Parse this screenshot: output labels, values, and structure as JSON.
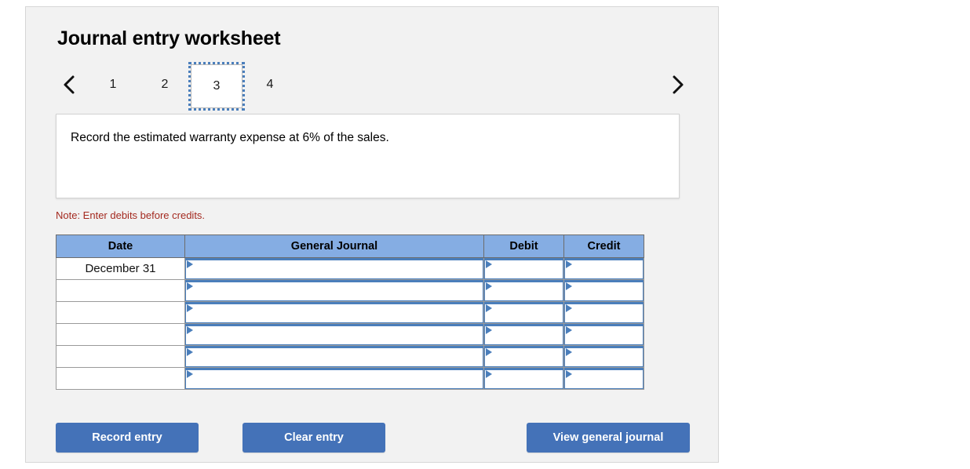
{
  "page": {
    "title": "Journal entry worksheet"
  },
  "pager": {
    "prev_icon": "chevron-left-icon",
    "next_icon": "chevron-right-icon",
    "tabs": [
      {
        "label": "1",
        "active": false
      },
      {
        "label": "2",
        "active": false
      },
      {
        "label": "3",
        "active": true
      },
      {
        "label": "4",
        "active": false
      }
    ]
  },
  "instruction": {
    "text": "Record the estimated warranty expense at 6% of the sales."
  },
  "note": {
    "text": "Note: Enter debits before credits."
  },
  "table": {
    "headers": {
      "date": "Date",
      "general_journal": "General Journal",
      "debit": "Debit",
      "credit": "Credit"
    },
    "rows": [
      {
        "date": "December 31",
        "general_journal": "",
        "debit": "",
        "credit": ""
      },
      {
        "date": "",
        "general_journal": "",
        "debit": "",
        "credit": ""
      },
      {
        "date": "",
        "general_journal": "",
        "debit": "",
        "credit": ""
      },
      {
        "date": "",
        "general_journal": "",
        "debit": "",
        "credit": ""
      },
      {
        "date": "",
        "general_journal": "",
        "debit": "",
        "credit": ""
      },
      {
        "date": "",
        "general_journal": "",
        "debit": "",
        "credit": ""
      }
    ]
  },
  "buttons": {
    "record_entry": "Record entry",
    "clear_entry": "Clear entry",
    "view_general_journal": "View general journal"
  },
  "colors": {
    "header_blue": "#85ade3",
    "button_blue": "#4472b8",
    "note_red": "#a42a20",
    "field_border_blue": "#4a7ebb",
    "panel_bg": "#f2f2f2"
  }
}
